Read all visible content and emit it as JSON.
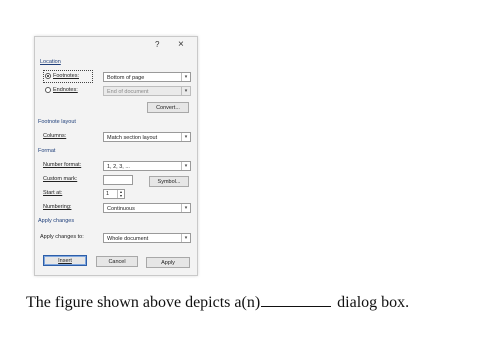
{
  "dialog": {
    "title_help": "?",
    "title_close": "×",
    "location": {
      "section_label": "Location",
      "footnotes_label": "Footnotes:",
      "footnotes_value": "Bottom of page",
      "endnotes_label": "Endnotes:",
      "endnotes_value": "End of document",
      "convert_label": "Convert..."
    },
    "footnote_layout": {
      "section_label": "Footnote layout",
      "columns_label": "Columns:",
      "columns_value": "Match section layout"
    },
    "format": {
      "section_label": "Format",
      "number_format_label": "Number format:",
      "number_format_value": "1, 2, 3, ...",
      "custom_mark_label": "Custom mark:",
      "symbol_label": "Symbol...",
      "start_at_label": "Start at:",
      "start_at_value": "1",
      "numbering_label": "Numbering:",
      "numbering_value": "Continuous"
    },
    "apply_changes": {
      "section_label": "Apply changes",
      "apply_to_label": "Apply changes to:",
      "apply_to_value": "Whole document"
    },
    "buttons": {
      "insert": "Insert",
      "cancel": "Cancel",
      "apply": "Apply"
    }
  },
  "question": {
    "before_blank": "The figure shown above depicts a(n)",
    "after_blank": "dialog box."
  },
  "colors": {
    "section_heading": "#1f3f7a",
    "default_button_border": "#2d5ea8"
  }
}
